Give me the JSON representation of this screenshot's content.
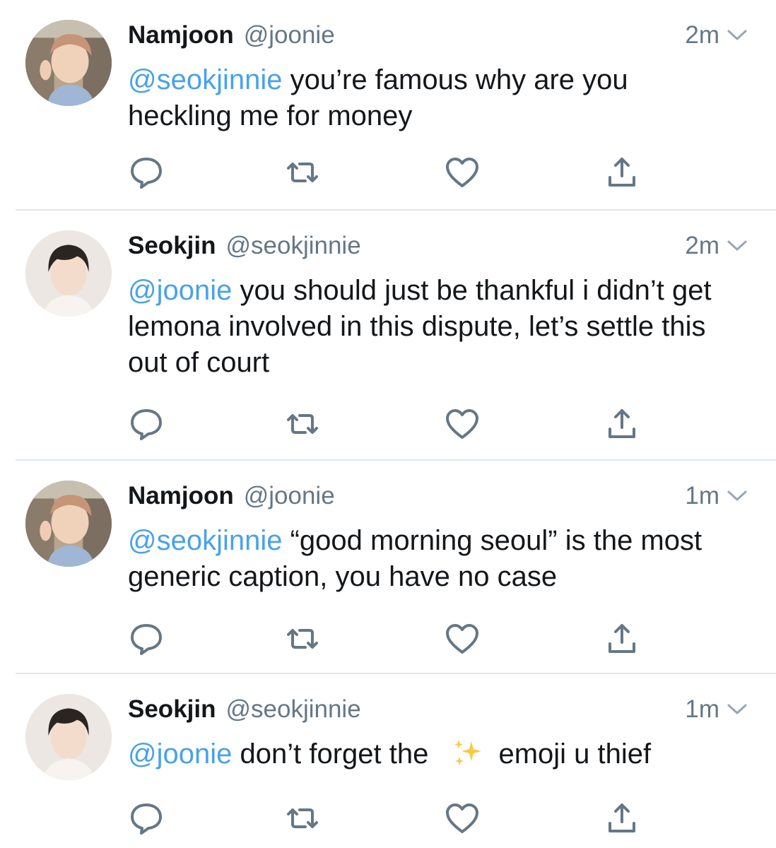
{
  "tweets": [
    {
      "name": "Namjoon",
      "handle": "@joonie",
      "time": "2m",
      "mention": "@seokjinnie",
      "text": " you’re famous why are you heckling me for money",
      "avatar": "namjoon-avatar"
    },
    {
      "name": "Seokjin",
      "handle": "@seokjinnie",
      "time": "2m",
      "mention": "@joonie",
      "text": " you should just be thankful i didn’t get lemona involved in this dispute, let’s settle this out of court",
      "avatar": "seokjin-avatar"
    },
    {
      "name": "Namjoon",
      "handle": "@joonie",
      "time": "1m",
      "mention": "@seokjinnie",
      "text": " “good morning seoul” is the most generic caption, you have no case",
      "avatar": "namjoon-avatar"
    },
    {
      "name": "Seokjin",
      "handle": "@seokjinnie",
      "time": "1m",
      "mention": "@joonie",
      "text_before": " don’t forget the ",
      "emoji": "sparkles-emoji",
      "text_after": "emoji u thief",
      "avatar": "seokjin-avatar"
    }
  ],
  "icons": {
    "reply": "reply-icon",
    "retweet": "retweet-icon",
    "like": "heart-icon",
    "share": "share-icon",
    "menu": "chevron-down-icon"
  },
  "colors": {
    "mention": "#4aa1ec",
    "secondary_text": "#657786",
    "icon": "#657786",
    "divider": "#e1e8ed"
  }
}
